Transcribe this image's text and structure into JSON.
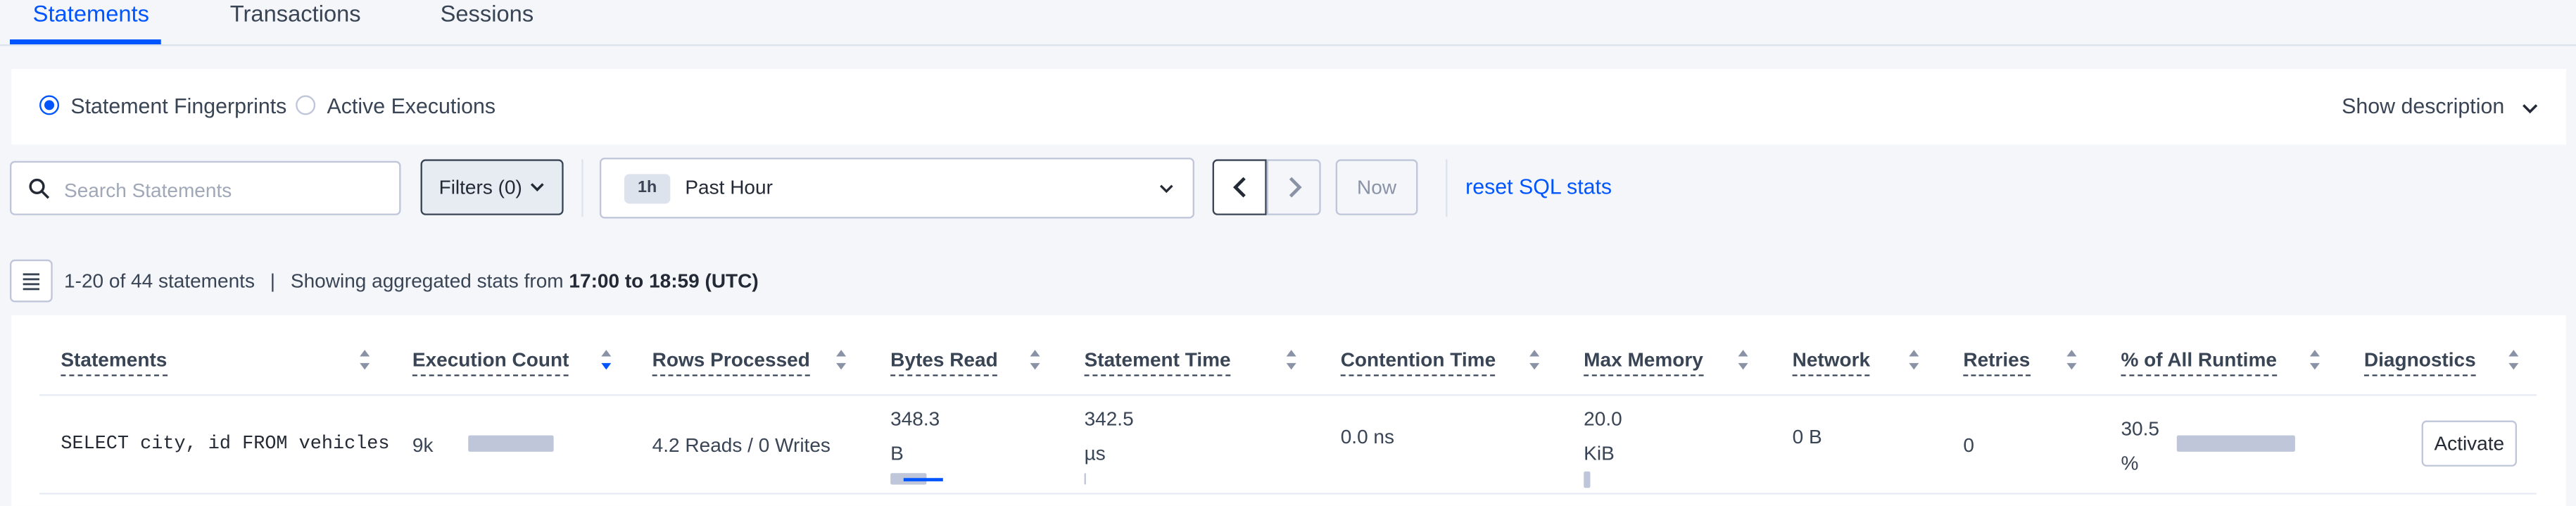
{
  "tabs": [
    {
      "label": "Statements",
      "active": true
    },
    {
      "label": "Transactions",
      "active": false
    },
    {
      "label": "Sessions",
      "active": false
    }
  ],
  "view_switch": {
    "options": [
      {
        "label": "Statement Fingerprints",
        "selected": true
      },
      {
        "label": "Active Executions",
        "selected": false
      }
    ],
    "show_description": "Show description"
  },
  "toolbar": {
    "search_placeholder": "Search Statements",
    "filters_label": "Filters (0)",
    "time_badge": "1h",
    "time_label": "Past Hour",
    "now_label": "Now",
    "reset_label": "reset SQL stats"
  },
  "summary": {
    "range": "1-20 of 44 statements",
    "prefix": "Showing aggregated stats from",
    "window": "17:00 to 18:59 (UTC)"
  },
  "table": {
    "columns": [
      "Statements",
      "Execution Count",
      "Rows Processed",
      "Bytes Read",
      "Statement Time",
      "Contention Time",
      "Max Memory",
      "Network",
      "Retries",
      "% of All Runtime",
      "Diagnostics"
    ],
    "sorted_column": "Execution Count",
    "rows": [
      {
        "statement": "SELECT city, id FROM vehicles",
        "execution_count": "9k",
        "rows_processed": "4.2 Reads / 0 Writes",
        "bytes_read_value": "348.3",
        "bytes_read_unit": "B",
        "statement_time_value": "342.5",
        "statement_time_unit": "µs",
        "contention_time": "0.0 ns",
        "max_memory_value": "20.0",
        "max_memory_unit": "KiB",
        "network": "0 B",
        "retries": "0",
        "runtime_value": "30.5",
        "runtime_unit": "%",
        "diagnostics_label": "Activate"
      }
    ]
  },
  "colors": {
    "accent": "#0055ff",
    "text": "#394455",
    "border": "#c0c6d9",
    "bar": "#c0c6d9"
  }
}
